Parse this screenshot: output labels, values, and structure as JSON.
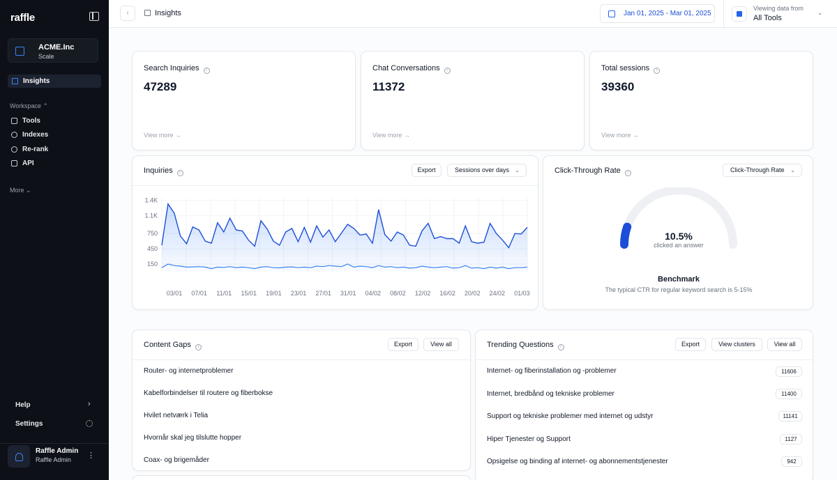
{
  "sidebar": {
    "logo": "raffle",
    "org": {
      "name": "ACME.Inc",
      "plan": "Scale"
    },
    "active_item": "Insights",
    "workspace_label": "Workspace ⌃",
    "items": [
      {
        "label": "Tools",
        "icon": "tools-icon"
      },
      {
        "label": "Indexes",
        "icon": "database-icon"
      },
      {
        "label": "Re-rank",
        "icon": "refresh-icon"
      },
      {
        "label": "API",
        "icon": "api-icon"
      }
    ],
    "more_label": "More ⌄",
    "help_label": "Help",
    "settings_label": "Settings",
    "user": {
      "name": "Raffle Admin",
      "sub": "Raffle Admin"
    }
  },
  "topbar": {
    "breadcrumb": "Insights",
    "date_range": "Jan 01, 2025 - Mar 01, 2025",
    "viewing_label": "Viewing data from",
    "viewing_value": "All Tools"
  },
  "stats": [
    {
      "label": "Search Inquiries",
      "value": "47289",
      "link": "View more →"
    },
    {
      "label": "Chat Conversations",
      "value": "11372",
      "link": "View more →"
    },
    {
      "label": "Total sessions",
      "value": "39360",
      "link": "View more →"
    }
  ],
  "inquiries": {
    "title": "Inquiries",
    "export_label": "Export",
    "select_value": "Sessions over days"
  },
  "chart_data": {
    "type": "area",
    "yticks": [
      "1.4K",
      "1.1K",
      "750",
      "450",
      "150"
    ],
    "ylim": [
      0,
      1450
    ],
    "xticks": [
      "03/01",
      "07/01",
      "11/01",
      "15/01",
      "19/01",
      "23/01",
      "27/01",
      "31/01",
      "04/02",
      "08/02",
      "12/02",
      "16/02",
      "20/02",
      "24/02",
      "01/03"
    ],
    "series": [
      {
        "color": "#1d4ed8",
        "values": [
          520,
          1330,
          1150,
          700,
          550,
          880,
          820,
          600,
          560,
          960,
          780,
          1050,
          820,
          800,
          620,
          500,
          1000,
          840,
          600,
          520,
          780,
          850,
          590,
          870,
          580,
          900,
          680,
          820,
          590,
          760,
          930,
          850,
          720,
          740,
          560,
          1220,
          730,
          600,
          780,
          720,
          520,
          500,
          800,
          950,
          650,
          690,
          650,
          650,
          560,
          900,
          590,
          560,
          580,
          950,
          750,
          620,
          470,
          750,
          740,
          870
        ]
      },
      {
        "color": "#3b82f6",
        "values": [
          80,
          150,
          120,
          110,
          90,
          95,
          100,
          90,
          60,
          90,
          85,
          100,
          80,
          90,
          80,
          60,
          90,
          100,
          80,
          75,
          90,
          95,
          80,
          90,
          80,
          110,
          100,
          120,
          110,
          100,
          150,
          90,
          110,
          100,
          80,
          120,
          90,
          100,
          80,
          90,
          70,
          80,
          110,
          90,
          80,
          90,
          100,
          70,
          80,
          120,
          70,
          80,
          60,
          90,
          70,
          90,
          60,
          80,
          80,
          90
        ]
      }
    ]
  },
  "ctr": {
    "title": "Click-Through Rate",
    "select_value": "Click-Through Rate",
    "value": "10.5%",
    "value_num": 10.5,
    "sub": "clicked an answer",
    "benchmark_title": "Benchmark",
    "benchmark_text": "The typical CTR for regular keyword search is 5-15%"
  },
  "content_gaps": {
    "title": "Content Gaps",
    "export_label": "Export",
    "view_all_label": "View all",
    "rows": [
      "Router- og internetproblemer",
      "Kabelforbindelser til routere og fiberbokse",
      "Hvilet netværk i Telia",
      "Hvornår skal jeg tilslutte hopper",
      "Coax- og brigemåder"
    ]
  },
  "trending": {
    "title": "Trending Questions",
    "export_label": "Export",
    "clusters_label": "View clusters",
    "view_all_label": "View all",
    "rows": [
      {
        "text": "Internet- og fiberinstallation og -problemer",
        "count": "11606"
      },
      {
        "text": "Internet, bredbånd og tekniske problemer",
        "count": "11400"
      },
      {
        "text": "Support og tekniske problemer med internet og udstyr",
        "count": "11141"
      },
      {
        "text": "Hiper Tjenester og Support",
        "count": "1127"
      },
      {
        "text": "Opsigelse og binding af internet- og abonnementstjenester",
        "count": "942"
      }
    ]
  }
}
